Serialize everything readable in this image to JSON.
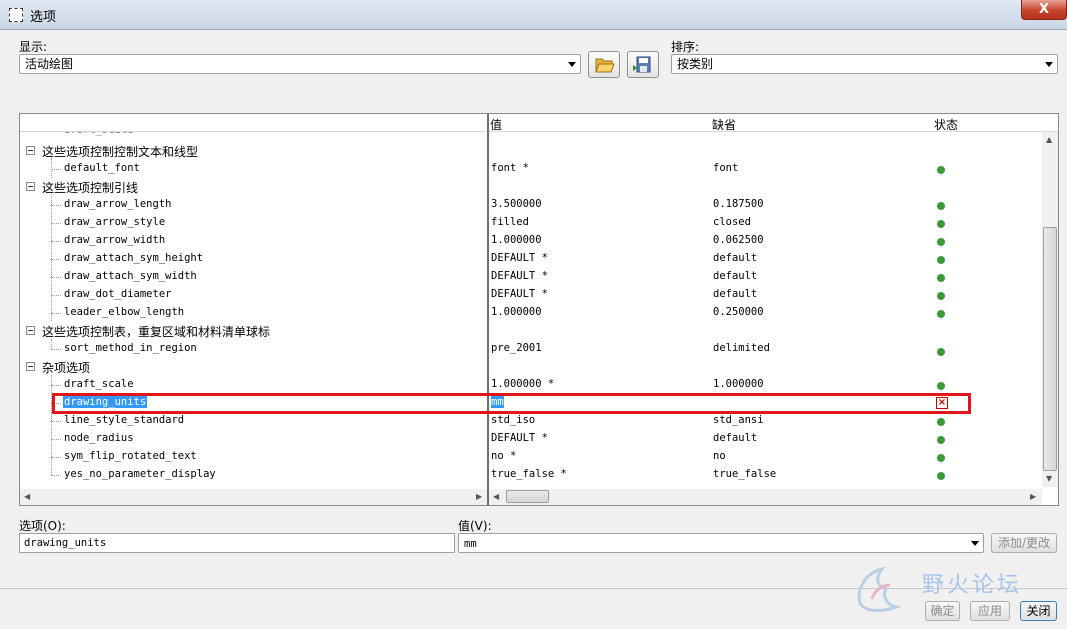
{
  "window": {
    "title": "选项",
    "close_label": "X"
  },
  "toolbar": {
    "show_label": "显示:",
    "show_value": "活动绘图",
    "sort_label": "排序:",
    "sort_value": "按类别",
    "open_icon": "folder-open-icon",
    "save_icon": "save-config-icon"
  },
  "table": {
    "headers": {
      "value": "值",
      "default": "缺省",
      "status": "状态"
    },
    "categories": [
      {
        "label": "这些选项控制控制文本和线型"
      },
      {
        "label": "这些选项控制引线"
      },
      {
        "label": "这些选项控制表，重复区域和材料清单球标"
      },
      {
        "label": "杂项选项"
      }
    ],
    "rows": [
      {
        "name": "default_font",
        "value": "font *",
        "default": "font"
      },
      {
        "name": "draw_arrow_length",
        "value": "3.500000",
        "default": "0.187500"
      },
      {
        "name": "draw_arrow_style",
        "value": "filled",
        "default": "closed"
      },
      {
        "name": "draw_arrow_width",
        "value": "1.000000",
        "default": "0.062500"
      },
      {
        "name": "draw_attach_sym_height",
        "value": "DEFAULT *",
        "default": "default"
      },
      {
        "name": "draw_attach_sym_width",
        "value": "DEFAULT *",
        "default": "default"
      },
      {
        "name": "draw_dot_diameter",
        "value": "DEFAULT *",
        "default": "default"
      },
      {
        "name": "leader_elbow_length",
        "value": "1.000000",
        "default": "0.250000"
      },
      {
        "name": "sort_method_in_region",
        "value": "pre_2001",
        "default": "delimited"
      },
      {
        "name": "draft_scale",
        "value": "1.000000 *",
        "default": "1.000000"
      },
      {
        "name": "drawing_units",
        "value": "mm",
        "default": ""
      },
      {
        "name": "line_style_standard",
        "value": "std_iso",
        "default": "std_ansi"
      },
      {
        "name": "node_radius",
        "value": "DEFAULT *",
        "default": "default"
      },
      {
        "name": "sym_flip_rotated_text",
        "value": "no *",
        "default": "no"
      },
      {
        "name": "yes_no_parameter_display",
        "value": "true_false *",
        "default": "true_false"
      }
    ],
    "status_ok_color": "#3c9a37",
    "status_error_color": "#c00000"
  },
  "form": {
    "option_label": "选项(O):",
    "option_value": "drawing_units",
    "value_label": "值(V):",
    "value_value": "mm",
    "add_change_label": "添加/更改"
  },
  "footer": {
    "ok_label": "确定",
    "apply_label": "应用",
    "close_label": "关闭"
  },
  "watermark": "野火论坛"
}
